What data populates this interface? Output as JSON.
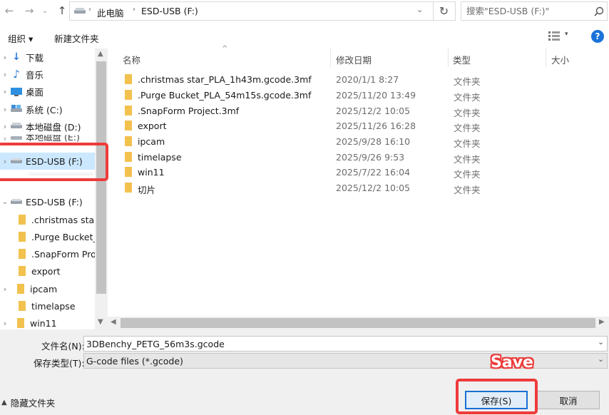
{
  "address_bar": {
    "crumbs": [
      "此电脑",
      "ESD-USB (F:)"
    ],
    "search_placeholder": "搜索\"ESD-USB (F:)\""
  },
  "toolbar": {
    "organize_label": "组织 ▾",
    "new_folder_label": "新建文件夹"
  },
  "sidebar": {
    "items": [
      {
        "label": "下载",
        "icon": "download-icon"
      },
      {
        "label": "音乐",
        "icon": "music-icon"
      },
      {
        "label": "桌面",
        "icon": "desktop-icon"
      },
      {
        "label": "系统 (C:)",
        "icon": "drive-icon"
      },
      {
        "label": "本地磁盘 (D:)",
        "icon": "drive-icon"
      },
      {
        "label": "本地磁盘 (E:)",
        "icon": "drive-icon"
      },
      {
        "label": "ESD-USB (F:)",
        "icon": "usb-drive-icon",
        "selected": true
      }
    ],
    "expanded_drive": "ESD-USB (F:)",
    "children": [
      ".christmas star_",
      ".Purge Bucket_F",
      ".SnapForm Proj",
      "export",
      "ipcam",
      "timelapse",
      "win11"
    ]
  },
  "columns": {
    "name": "名称",
    "date": "修改日期",
    "type": "类型",
    "size": "大小"
  },
  "files": [
    {
      "name": ".christmas star_PLA_1h43m.gcode.3mf",
      "date": "2020/1/1 8:27",
      "type": "文件夹"
    },
    {
      "name": ".Purge Bucket_PLA_54m15s.gcode.3mf",
      "date": "2025/11/20 13:49",
      "type": "文件夹"
    },
    {
      "name": ".SnapForm Project.3mf",
      "date": "2025/12/2 10:05",
      "type": "文件夹"
    },
    {
      "name": "export",
      "date": "2025/11/26 16:28",
      "type": "文件夹"
    },
    {
      "name": "ipcam",
      "date": "2025/9/28 16:10",
      "type": "文件夹"
    },
    {
      "name": "timelapse",
      "date": "2025/9/26 9:53",
      "type": "文件夹"
    },
    {
      "name": "win11",
      "date": "2025/7/22 16:04",
      "type": "文件夹"
    },
    {
      "name": "切片",
      "date": "2025/12/2 10:05",
      "type": "文件夹"
    }
  ],
  "save_panel": {
    "filename_label": "文件名(N):",
    "filename_value": "3DBenchy_PETG_56m3s.gcode",
    "filetype_label": "保存类型(T):",
    "filetype_value": "G-code files (*.gcode)",
    "hide_folders_label": "隐藏文件夹",
    "save_button": "保存(S)",
    "cancel_button": "取消"
  },
  "annotation": {
    "save_text": "Save",
    "highlight_color": "#ee3b3b"
  },
  "colors": {
    "selection": "#cce8ff",
    "folder": "#f2c14e",
    "panel": "#f0f0f0"
  }
}
